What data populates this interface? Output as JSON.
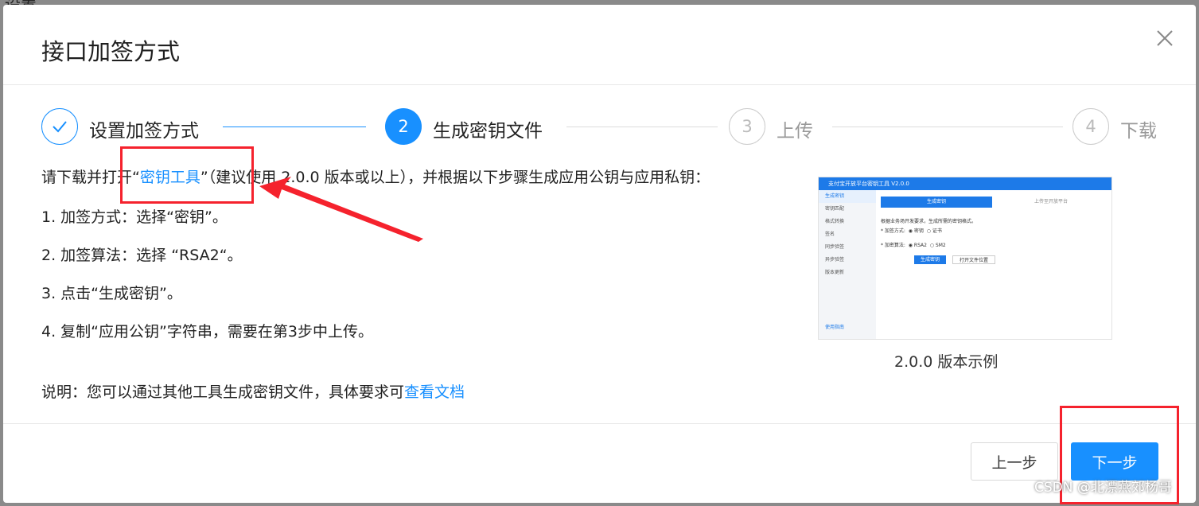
{
  "modal": {
    "title": "接口加签方式",
    "steps": [
      {
        "number": "1",
        "label": "设置加签方式",
        "state": "done"
      },
      {
        "number": "2",
        "label": "生成密钥文件",
        "state": "active"
      },
      {
        "number": "3",
        "label": "上传",
        "state": "pending"
      },
      {
        "number": "4",
        "label": "下载",
        "state": "pending"
      }
    ],
    "intro": {
      "before": "请下载并打开“",
      "link": "密钥工具",
      "after": "”（建议使用 2.0.0 版本或以上），并根据以下步骤生成应用公钥与应用私钥："
    },
    "instructions": [
      "1. 加签方式：选择“密钥”。",
      "2. 加签算法：选择 “RSA2“。",
      "3. 点击“生成密钥”。",
      "4. 复制“应用公钥”字符串，需要在第3步中上传。"
    ],
    "note": {
      "before": "说明：您可以通过其他工具生成密钥文件，具体要求可",
      "link": "查看文档"
    },
    "preview": {
      "window_title": "支付宝开放平台密钥工具 V2.0.0",
      "sidebar": [
        "生成密钥",
        "密钥匹配",
        "格式转换",
        "签名",
        "同步验签",
        "异步验签",
        "版本更新"
      ],
      "help": "使用指南",
      "tabs": [
        "生成密钥",
        "上传至开放平台"
      ],
      "hint": "根据业务场开发要求，生成所需的密钥格式。",
      "method_label": "* 加签方式:",
      "method_options": [
        "密钥",
        "证书"
      ],
      "algo_label": "* 加密算法:",
      "algo_options": [
        "RSA2",
        "SM2"
      ],
      "generate_button": "生成密钥",
      "open_button": "打开文件位置"
    },
    "caption": "2.0.0 版本示例",
    "buttons": {
      "prev": "上一步",
      "next": "下一步"
    }
  },
  "watermark": "CSDN @北漂燕郊杨哥",
  "colors": {
    "primary": "#1890ff",
    "annotation": "#f5222d"
  }
}
